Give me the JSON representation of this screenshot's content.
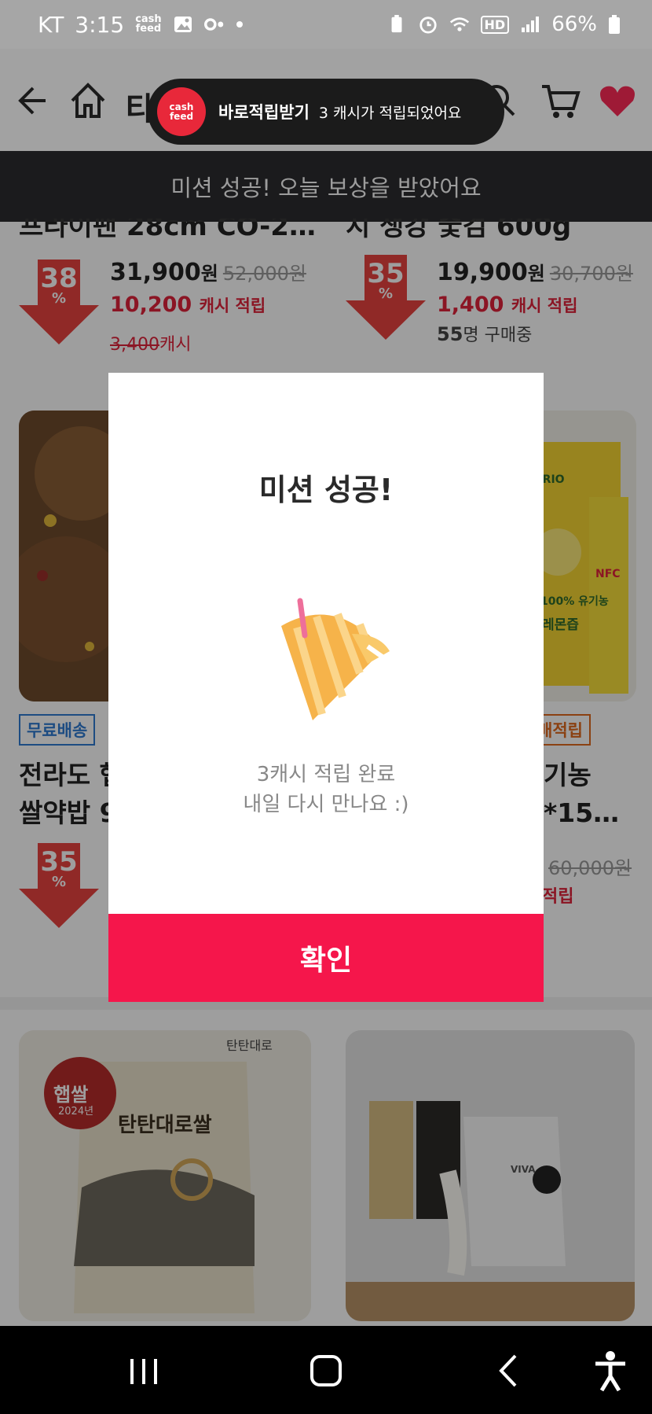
{
  "status_bar": {
    "carrier": "KT",
    "time": "3:15",
    "cashfeed_mini_top": "cash",
    "cashfeed_mini_bottom": "feed",
    "network": "HD",
    "battery": "66%"
  },
  "header": {
    "title_partial": "타"
  },
  "toast": {
    "logo_top": "cash",
    "logo_bottom": "feed",
    "title": "바로적립받기",
    "message": "3 캐시가 적립되었어요"
  },
  "banner": {
    "text": "미션 성공! 오늘 보상을 받았어요"
  },
  "products_row1": [
    {
      "name_partial": "프라이팬 28cm CO-2…",
      "discount": "38",
      "percent": "%",
      "price": "31,900",
      "won": "원",
      "old_price": "52,000",
      "cash": "10,200",
      "cash_label": "캐시 적립",
      "sub_amount": "3,400",
      "sub_label": "캐시"
    },
    {
      "name_partial": "지 생강 숯검 600g",
      "discount": "35",
      "percent": "%",
      "price": "19,900",
      "won": "원",
      "old_price": "30,700",
      "cash": "1,400",
      "cash_label": "캐시 적립",
      "buyers": "55",
      "buyers_label": "명 구매중"
    }
  ],
  "products_row2": [
    {
      "tag": "무료배송",
      "name_line1": "전라도 햅",
      "name_line2": "쌀약밥 9",
      "discount": "35",
      "percent": "%"
    },
    {
      "tag": "배적립",
      "name_line1": "기농",
      "name_line2": "*15…",
      "old_price": "60,000",
      "won": "원",
      "cash_partial": "적립",
      "package_text_1": "BRIO",
      "package_text_2": "100% 유기농",
      "package_text_3": "레몬즙",
      "package_text_4": "NFC"
    }
  ],
  "products_row3": [
    {
      "badge_line1": "햅쌀",
      "badge_line2": "2024년",
      "brand": "탄탄대로",
      "rice_name": "탄탄대로쌀"
    },
    {
      "appliance_brand": "VIVA"
    }
  ],
  "modal": {
    "title": "미션 성공!",
    "message_line1": "3캐시 적립 완료",
    "message_line2": "내일 다시 만나요 :)",
    "confirm": "확인"
  },
  "colors": {
    "accent": "#f5164b",
    "cash_red": "#e0233a",
    "discount_arrow": "#e8433f",
    "banner_bg": "#1b1b1d",
    "cashfeed_brand": "#e8283a"
  },
  "icons": [
    "back-arrow-icon",
    "home-icon",
    "search-icon",
    "cart-icon",
    "heart-icon",
    "party-popper-icon",
    "recent-apps-icon",
    "home-nav-icon",
    "back-nav-icon",
    "accessibility-icon"
  ]
}
